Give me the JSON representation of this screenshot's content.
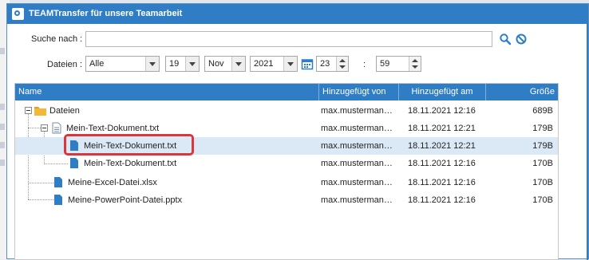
{
  "window": {
    "title": "TEAMTransfer für unsere Teamarbeit"
  },
  "search": {
    "label": "Suche nach :",
    "value": "",
    "placeholder": ""
  },
  "filter": {
    "label": "Dateien :",
    "type_value": "Alle",
    "day_value": "19",
    "month_value": "Nov",
    "year_value": "2021",
    "hour_value": "23",
    "time_separator": ":",
    "minute_value": "59"
  },
  "icons": {
    "search": "search-icon",
    "clear": "clear-icon",
    "calendar": "calendar-icon",
    "folder": "folder-icon",
    "file": "file-icon"
  },
  "colors": {
    "accent": "#2f7dc4",
    "selection": "#dbe9f7",
    "highlight": "#d9363e",
    "folder": "#f3b73a",
    "file": "#2f7dc4"
  },
  "table": {
    "columns": [
      "Name",
      "Hinzugefügt von",
      "Hinzugefügt am",
      "Größe"
    ],
    "rows": [
      {
        "name": "Dateien",
        "by": "max.musterman…",
        "at": "18.11.2021 12:16",
        "size": "689B"
      },
      {
        "name": "Mein-Text-Dokument.txt",
        "by": "max.musterman…",
        "at": "18.11.2021 12:21",
        "size": "179B"
      },
      {
        "name": "Mein-Text-Dokument.txt",
        "by": "max.musterman…",
        "at": "18.11.2021 12:21",
        "size": "179B"
      },
      {
        "name": "Mein-Text-Dokument.txt",
        "by": "max.musterman…",
        "at": "18.11.2021 12:16",
        "size": "170B"
      },
      {
        "name": "Meine-Excel-Datei.xlsx",
        "by": "max.musterman…",
        "at": "18.11.2021 12:16",
        "size": "170B"
      },
      {
        "name": "Meine-PowerPoint-Datei.pptx",
        "by": "max.musterman…",
        "at": "18.11.2021 12:16",
        "size": "170B"
      }
    ]
  }
}
